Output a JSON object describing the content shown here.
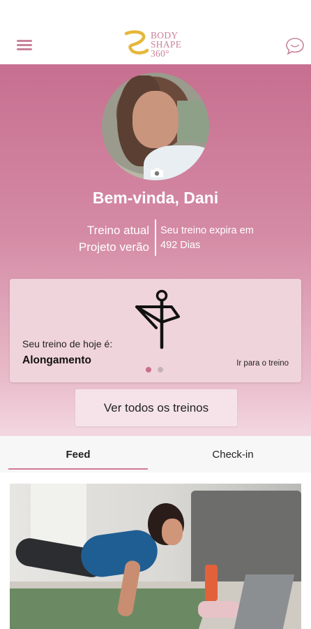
{
  "header": {
    "logo_lines": [
      "BODY",
      "SHAPE",
      "360°"
    ],
    "menu_icon": "hamburger-icon",
    "chat_icon": "chat-bubble-icon"
  },
  "profile": {
    "welcome": "Bem-vinda, Dani",
    "treino_label": "Treino atual",
    "treino_name": "Projeto verão",
    "expira_label": "Seu treino expira em",
    "expira_value": "492 Dias",
    "camera_icon": "camera-icon"
  },
  "today_card": {
    "label": "Seu treino de hoje é:",
    "workout": "Alongamento",
    "link": "Ir para o treino",
    "icon": "stretch-pose-icon",
    "pages": 2,
    "active_page": 1
  },
  "all_workouts_button": "Ver todos os treinos",
  "tabs": [
    {
      "label": "Feed",
      "active": true
    },
    {
      "label": "Check-in",
      "active": false
    }
  ],
  "colors": {
    "accent": "#c9708f",
    "hero_top": "#c76f90",
    "hero_bottom": "#f3d8e1",
    "card": "#f0d4dc"
  }
}
